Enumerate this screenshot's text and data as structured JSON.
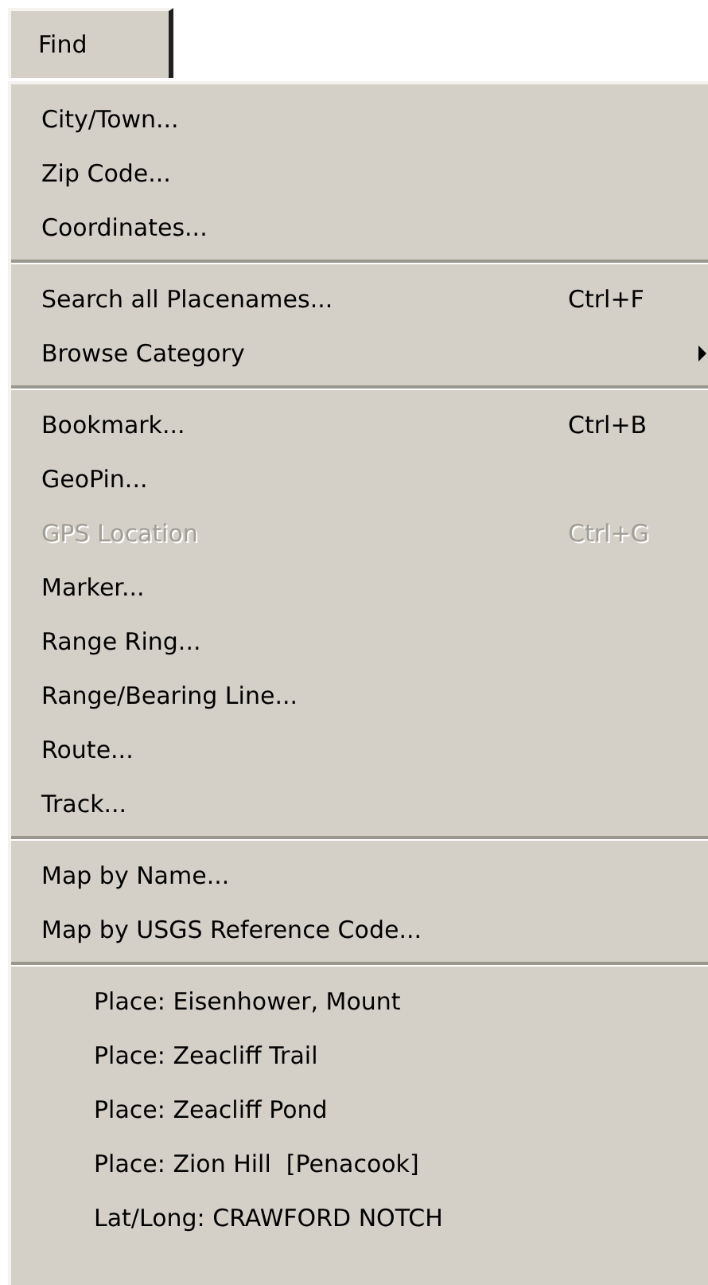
{
  "menu_title": "Find",
  "sections": [
    {
      "items": [
        {
          "kind": "command",
          "label": "City/Town...",
          "disabled": false
        },
        {
          "kind": "command",
          "label": "Zip Code...",
          "disabled": false
        },
        {
          "kind": "command",
          "label": "Coordinates...",
          "disabled": false
        }
      ]
    },
    {
      "items": [
        {
          "kind": "command",
          "label": "Search all Placenames...",
          "shortcut": "Ctrl+F",
          "disabled": false
        },
        {
          "kind": "submenu",
          "label": "Browse Category",
          "disabled": false
        }
      ]
    },
    {
      "items": [
        {
          "kind": "command",
          "label": "Bookmark...",
          "shortcut": "Ctrl+B",
          "disabled": false
        },
        {
          "kind": "command",
          "label": "GeoPin...",
          "disabled": false
        },
        {
          "kind": "command",
          "label": "GPS Location",
          "shortcut": "Ctrl+G",
          "disabled": true
        },
        {
          "kind": "command",
          "label": "Marker...",
          "disabled": false
        },
        {
          "kind": "command",
          "label": "Range Ring...",
          "disabled": false
        },
        {
          "kind": "command",
          "label": "Range/Bearing Line...",
          "disabled": false
        },
        {
          "kind": "command",
          "label": "Route...",
          "disabled": false
        },
        {
          "kind": "command",
          "label": "Track...",
          "disabled": false
        }
      ]
    },
    {
      "items": [
        {
          "kind": "command",
          "label": "Map by Name...",
          "disabled": false
        },
        {
          "kind": "command",
          "label": "Map by USGS Reference Code...",
          "disabled": false
        }
      ]
    },
    {
      "items": [
        {
          "kind": "recent",
          "label": "Place: Eisenhower, Mount",
          "disabled": false
        },
        {
          "kind": "recent",
          "label": "Place: Zeacliff Trail",
          "disabled": false
        },
        {
          "kind": "recent",
          "label": "Place: Zeacliff Pond",
          "disabled": false
        },
        {
          "kind": "recent",
          "label": "Place: Zion Hill  [Penacook]",
          "disabled": false
        },
        {
          "kind": "recent",
          "label": "Lat/Long: CRAWFORD NOTCH",
          "disabled": false
        }
      ]
    }
  ]
}
